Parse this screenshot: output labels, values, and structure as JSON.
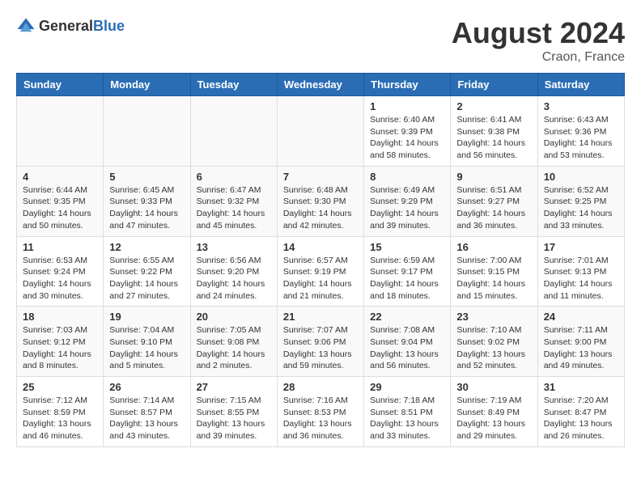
{
  "logo": {
    "text_general": "General",
    "text_blue": "Blue"
  },
  "title": {
    "month_year": "August 2024",
    "location": "Craon, France"
  },
  "weekdays": [
    "Sunday",
    "Monday",
    "Tuesday",
    "Wednesday",
    "Thursday",
    "Friday",
    "Saturday"
  ],
  "weeks": [
    [
      {
        "day": "",
        "info": ""
      },
      {
        "day": "",
        "info": ""
      },
      {
        "day": "",
        "info": ""
      },
      {
        "day": "",
        "info": ""
      },
      {
        "day": "1",
        "info": "Sunrise: 6:40 AM\nSunset: 9:39 PM\nDaylight: 14 hours\nand 58 minutes."
      },
      {
        "day": "2",
        "info": "Sunrise: 6:41 AM\nSunset: 9:38 PM\nDaylight: 14 hours\nand 56 minutes."
      },
      {
        "day": "3",
        "info": "Sunrise: 6:43 AM\nSunset: 9:36 PM\nDaylight: 14 hours\nand 53 minutes."
      }
    ],
    [
      {
        "day": "4",
        "info": "Sunrise: 6:44 AM\nSunset: 9:35 PM\nDaylight: 14 hours\nand 50 minutes."
      },
      {
        "day": "5",
        "info": "Sunrise: 6:45 AM\nSunset: 9:33 PM\nDaylight: 14 hours\nand 47 minutes."
      },
      {
        "day": "6",
        "info": "Sunrise: 6:47 AM\nSunset: 9:32 PM\nDaylight: 14 hours\nand 45 minutes."
      },
      {
        "day": "7",
        "info": "Sunrise: 6:48 AM\nSunset: 9:30 PM\nDaylight: 14 hours\nand 42 minutes."
      },
      {
        "day": "8",
        "info": "Sunrise: 6:49 AM\nSunset: 9:29 PM\nDaylight: 14 hours\nand 39 minutes."
      },
      {
        "day": "9",
        "info": "Sunrise: 6:51 AM\nSunset: 9:27 PM\nDaylight: 14 hours\nand 36 minutes."
      },
      {
        "day": "10",
        "info": "Sunrise: 6:52 AM\nSunset: 9:25 PM\nDaylight: 14 hours\nand 33 minutes."
      }
    ],
    [
      {
        "day": "11",
        "info": "Sunrise: 6:53 AM\nSunset: 9:24 PM\nDaylight: 14 hours\nand 30 minutes."
      },
      {
        "day": "12",
        "info": "Sunrise: 6:55 AM\nSunset: 9:22 PM\nDaylight: 14 hours\nand 27 minutes."
      },
      {
        "day": "13",
        "info": "Sunrise: 6:56 AM\nSunset: 9:20 PM\nDaylight: 14 hours\nand 24 minutes."
      },
      {
        "day": "14",
        "info": "Sunrise: 6:57 AM\nSunset: 9:19 PM\nDaylight: 14 hours\nand 21 minutes."
      },
      {
        "day": "15",
        "info": "Sunrise: 6:59 AM\nSunset: 9:17 PM\nDaylight: 14 hours\nand 18 minutes."
      },
      {
        "day": "16",
        "info": "Sunrise: 7:00 AM\nSunset: 9:15 PM\nDaylight: 14 hours\nand 15 minutes."
      },
      {
        "day": "17",
        "info": "Sunrise: 7:01 AM\nSunset: 9:13 PM\nDaylight: 14 hours\nand 11 minutes."
      }
    ],
    [
      {
        "day": "18",
        "info": "Sunrise: 7:03 AM\nSunset: 9:12 PM\nDaylight: 14 hours\nand 8 minutes."
      },
      {
        "day": "19",
        "info": "Sunrise: 7:04 AM\nSunset: 9:10 PM\nDaylight: 14 hours\nand 5 minutes."
      },
      {
        "day": "20",
        "info": "Sunrise: 7:05 AM\nSunset: 9:08 PM\nDaylight: 14 hours\nand 2 minutes."
      },
      {
        "day": "21",
        "info": "Sunrise: 7:07 AM\nSunset: 9:06 PM\nDaylight: 13 hours\nand 59 minutes."
      },
      {
        "day": "22",
        "info": "Sunrise: 7:08 AM\nSunset: 9:04 PM\nDaylight: 13 hours\nand 56 minutes."
      },
      {
        "day": "23",
        "info": "Sunrise: 7:10 AM\nSunset: 9:02 PM\nDaylight: 13 hours\nand 52 minutes."
      },
      {
        "day": "24",
        "info": "Sunrise: 7:11 AM\nSunset: 9:00 PM\nDaylight: 13 hours\nand 49 minutes."
      }
    ],
    [
      {
        "day": "25",
        "info": "Sunrise: 7:12 AM\nSunset: 8:59 PM\nDaylight: 13 hours\nand 46 minutes."
      },
      {
        "day": "26",
        "info": "Sunrise: 7:14 AM\nSunset: 8:57 PM\nDaylight: 13 hours\nand 43 minutes."
      },
      {
        "day": "27",
        "info": "Sunrise: 7:15 AM\nSunset: 8:55 PM\nDaylight: 13 hours\nand 39 minutes."
      },
      {
        "day": "28",
        "info": "Sunrise: 7:16 AM\nSunset: 8:53 PM\nDaylight: 13 hours\nand 36 minutes."
      },
      {
        "day": "29",
        "info": "Sunrise: 7:18 AM\nSunset: 8:51 PM\nDaylight: 13 hours\nand 33 minutes."
      },
      {
        "day": "30",
        "info": "Sunrise: 7:19 AM\nSunset: 8:49 PM\nDaylight: 13 hours\nand 29 minutes."
      },
      {
        "day": "31",
        "info": "Sunrise: 7:20 AM\nSunset: 8:47 PM\nDaylight: 13 hours\nand 26 minutes."
      }
    ]
  ]
}
